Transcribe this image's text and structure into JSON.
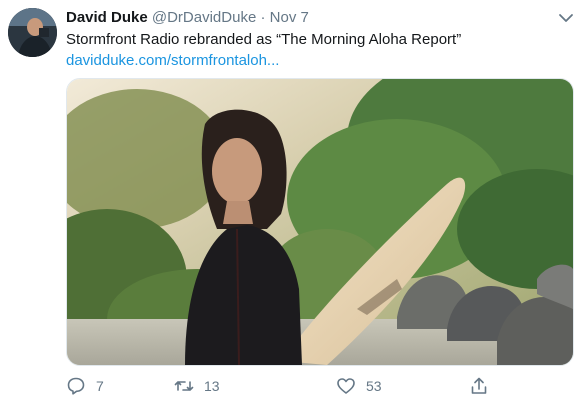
{
  "tweet": {
    "author_name": "David Duke",
    "author_handle": "@DrDavidDuke",
    "separator": "·",
    "timestamp": "Nov 7",
    "text": "Stormfront Radio rebranded as “The Morning Aloha Report”",
    "link_text": "davidduke.com/stormfrontaloh...",
    "media": {
      "subject": "woman in wetsuit holding surfboard in front of greenery and rocks"
    },
    "actions": {
      "reply_count": "7",
      "retweet_count": "13",
      "like_count": "53"
    }
  },
  "icons": {
    "reply": "reply-icon",
    "retweet": "retweet-icon",
    "like": "heart-icon",
    "share": "share-icon",
    "menu": "chevron-down-icon"
  },
  "colors": {
    "link": "#1b95e0",
    "muted": "#657786",
    "text": "#14171a"
  }
}
